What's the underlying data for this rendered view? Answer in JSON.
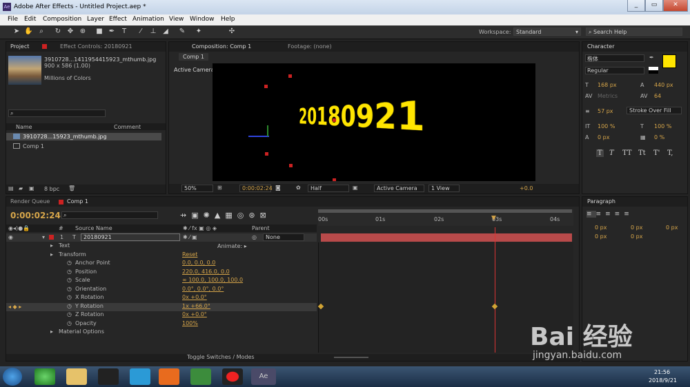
{
  "window": {
    "title": "Adobe After Effects - Untitled Project.aep *",
    "app_icon": "Ae"
  },
  "menu": [
    "File",
    "Edit",
    "Composition",
    "Layer",
    "Effect",
    "Animation",
    "View",
    "Window",
    "Help"
  ],
  "toolbar": {
    "workspace_label": "Workspace:",
    "workspace_value": "Standard",
    "search_placeholder": "Search Help"
  },
  "project": {
    "tab": "Project",
    "effect_tab": "Effect Controls: 20180921",
    "item_name": "3910728...1411954415923_mthumb.jpg",
    "item_dims": "900 x 586 (1.00)",
    "item_colors": "Millions of Colors",
    "col_name": "Name",
    "col_comment": "Comment",
    "items": [
      "3910728...15923_mthumb.jpg",
      "Comp 1"
    ],
    "bpc": "8 bpc"
  },
  "composition": {
    "tab": "Composition: Comp 1",
    "footage_tab": "Footage: (none)",
    "comp_tab": "Comp 1",
    "view_label": "Active Camera",
    "text": "20180921",
    "zoom": "50%",
    "timecode": "0:00:02:24",
    "resolution": "Half",
    "camera": "Active Camera",
    "views": "1 View",
    "exposure": "+0.0"
  },
  "character": {
    "tab": "Character",
    "font": "楷体",
    "style": "Regular",
    "size": "168 px",
    "leading": "440 px",
    "kerning": "Metrics",
    "tracking": "64",
    "stroke_width": "57 px",
    "stroke_mode": "Stroke Over Fill",
    "vscale": "100 %",
    "hscale": "100 %",
    "baseline": "0 px",
    "tsume": "0 %",
    "fill_color": "#ffe500",
    "style_buttons": [
      "T",
      "T",
      "TT",
      "Tt",
      "T'",
      "T,"
    ]
  },
  "paragraph": {
    "tab": "Paragraph",
    "indent_values": [
      "0 px",
      "0 px",
      "0 px",
      "0 px",
      "0 px"
    ]
  },
  "timeline": {
    "render_tab": "Render Queue",
    "comp_tab": "Comp 1",
    "timecode": "0:00:02:24",
    "col_source": "Source Name",
    "col_parent": "Parent",
    "col_num": "#",
    "layer_num": "1",
    "layer_name": "20180921",
    "parent_value": "None",
    "animate_label": "Animate:",
    "toggle_label": "Toggle Switches / Modes",
    "ruler": [
      "00s",
      "01s",
      "02s",
      "03s",
      "04s"
    ]
  },
  "properties": [
    {
      "name": "Text",
      "indent": 1,
      "value": ""
    },
    {
      "name": "Transform",
      "indent": 1,
      "value": "Reset"
    },
    {
      "name": "Anchor Point",
      "indent": 2,
      "value": "0.0, 0.0, 0.0"
    },
    {
      "name": "Position",
      "indent": 2,
      "value": "220.0, 416.0, 0.0"
    },
    {
      "name": "Scale",
      "indent": 2,
      "value": "∞ 100.0, 100.0, 100.0"
    },
    {
      "name": "Orientation",
      "indent": 2,
      "value": "0.0°, 0.0°, 0.0°"
    },
    {
      "name": "X Rotation",
      "indent": 2,
      "value": "0x +0.0°"
    },
    {
      "name": "Y Rotation",
      "indent": 2,
      "value": "1x +66.0°"
    },
    {
      "name": "Z Rotation",
      "indent": 2,
      "value": "0x +0.0°"
    },
    {
      "name": "Opacity",
      "indent": 2,
      "value": "100%"
    },
    {
      "name": "Material Options",
      "indent": 1,
      "value": ""
    }
  ],
  "taskbar": {
    "time": "21:56",
    "date": "2018/9/21"
  },
  "watermark": {
    "brand": "Bai 经验",
    "url": "jingyan.baidu.com"
  }
}
